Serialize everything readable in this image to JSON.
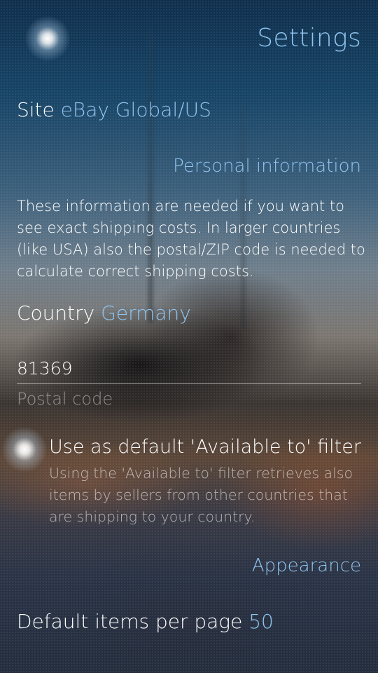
{
  "header": {
    "title": "Settings",
    "menu_icon": "pulley-menu-indicator"
  },
  "site": {
    "label": "Site",
    "value": "eBay Global/US"
  },
  "personal_information": {
    "header": "Personal information",
    "description": "These information are needed if you want to see exact shipping costs. In larger countries (like USA) also the postal/ZIP code is needed to calculate correct shipping costs.",
    "country_label": "Country",
    "country_value": "Germany",
    "postal_code_value": "81369",
    "postal_code_label": "Postal code"
  },
  "available_to_switch": {
    "checked": true,
    "title": "Use as default 'Available to' filter",
    "description": "Using the 'Available to' filter retrieves also items by sellers from other countries that are shipping to your country."
  },
  "appearance": {
    "header": "Appearance",
    "items_per_page_label": "Default items per page",
    "items_per_page_value": "50"
  },
  "colors": {
    "accent": "#8fc4ef",
    "text": "#ffffff",
    "secondary_text": "#a9aeb4"
  }
}
